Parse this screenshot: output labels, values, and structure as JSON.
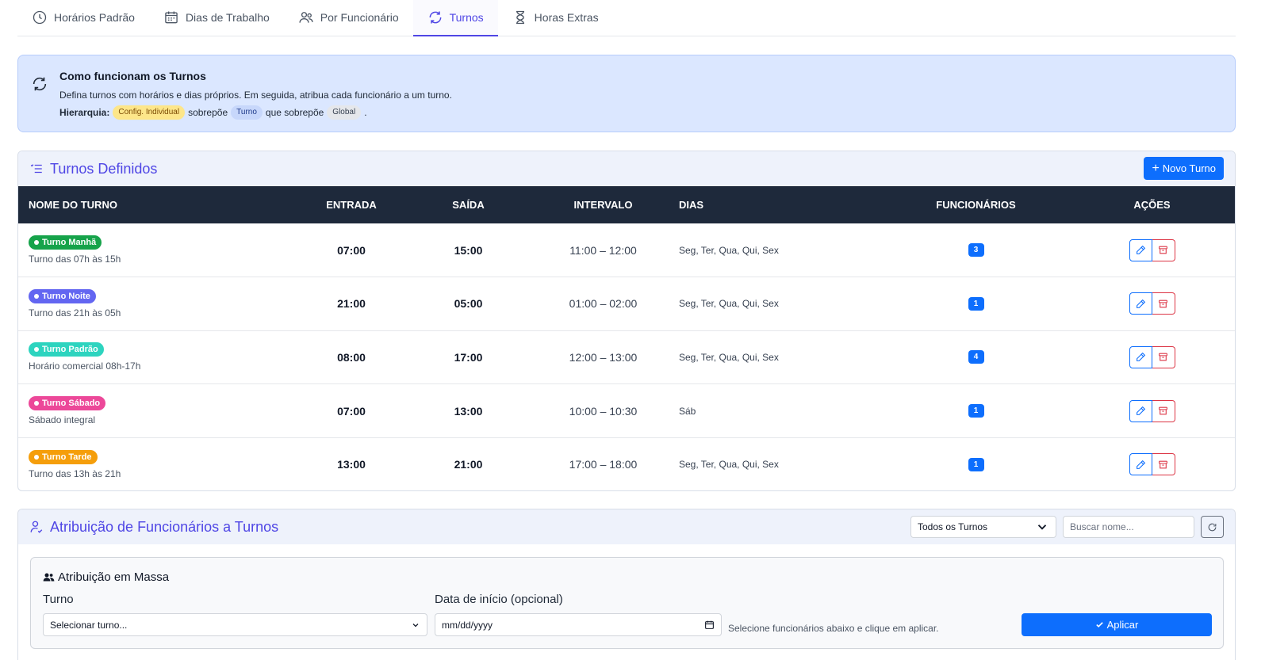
{
  "tabs": [
    {
      "label": "Horários Padrão",
      "icon": "clock-icon"
    },
    {
      "label": "Dias de Trabalho",
      "icon": "calendar-icon"
    },
    {
      "label": "Por Funcionário",
      "icon": "users-icon"
    },
    {
      "label": "Turnos",
      "icon": "rotate-icon",
      "active": true
    },
    {
      "label": "Horas Extras",
      "icon": "hourglass-icon"
    }
  ],
  "info": {
    "title": "Como funcionam os Turnos",
    "description": "Defina turnos com horários e dias próprios. Em seguida, atribua cada funcionário a um turno.",
    "hierarchy_label": "Hierarquia:",
    "chip_individual": "Config. Individual",
    "overrides_1": "sobrepõe",
    "chip_turno": "Turno",
    "overrides_2": "que sobrepõe",
    "chip_global": "Global",
    "period": "."
  },
  "shifts_card": {
    "title": "Turnos Definidos",
    "new_button": "Novo Turno",
    "columns": {
      "name": "NOME DO TURNO",
      "in": "ENTRADA",
      "out": "SAÍDA",
      "interval": "INTERVALO",
      "days": "DIAS",
      "employees": "FUNCIONÁRIOS",
      "actions": "AÇÕES"
    },
    "rows": [
      {
        "name": "Turno Manhã",
        "color": "#16a34a",
        "desc": "Turno das 07h às 15h",
        "in": "07:00",
        "out": "15:00",
        "interval": "11:00 – 12:00",
        "days": "Seg, Ter, Qua, Qui, Sex",
        "count": "3"
      },
      {
        "name": "Turno Noite",
        "color": "#6366f1",
        "desc": "Turno das 21h às 05h",
        "in": "21:00",
        "out": "05:00",
        "interval": "01:00 – 02:00",
        "days": "Seg, Ter, Qua, Qui, Sex",
        "count": "1"
      },
      {
        "name": "Turno Padrão",
        "color": "#2dd4bf",
        "desc": "Horário comercial 08h-17h",
        "in": "08:00",
        "out": "17:00",
        "interval": "12:00 – 13:00",
        "days": "Seg, Ter, Qua, Qui, Sex",
        "count": "4"
      },
      {
        "name": "Turno Sábado",
        "color": "#ec4899",
        "desc": "Sábado integral",
        "in": "07:00",
        "out": "13:00",
        "interval": "10:00 – 10:30",
        "days": "Sáb",
        "count": "1"
      },
      {
        "name": "Turno Tarde",
        "color": "#f59e0b",
        "desc": "Turno das 13h às 21h",
        "in": "13:00",
        "out": "21:00",
        "interval": "17:00 – 18:00",
        "days": "Seg, Ter, Qua, Qui, Sex",
        "count": "1"
      }
    ]
  },
  "assign_card": {
    "title": "Atribuição de Funcionários a Turnos",
    "filter_value": "Todos os Turnos",
    "search_placeholder": "Buscar nome...",
    "mass": {
      "title": "Atribuição em Massa",
      "shift_label": "Turno",
      "shift_value": "Selecionar turno...",
      "date_label": "Data de início (opcional)",
      "date_value": "mm/dd/yyyy",
      "hint": "Selecione funcionários abaixo e clique em aplicar.",
      "apply": "Aplicar"
    }
  },
  "colors": {
    "accent": "#4f46e5",
    "primary": "#0d6efd",
    "danger": "#dc3545",
    "table_header": "#1e293b"
  }
}
